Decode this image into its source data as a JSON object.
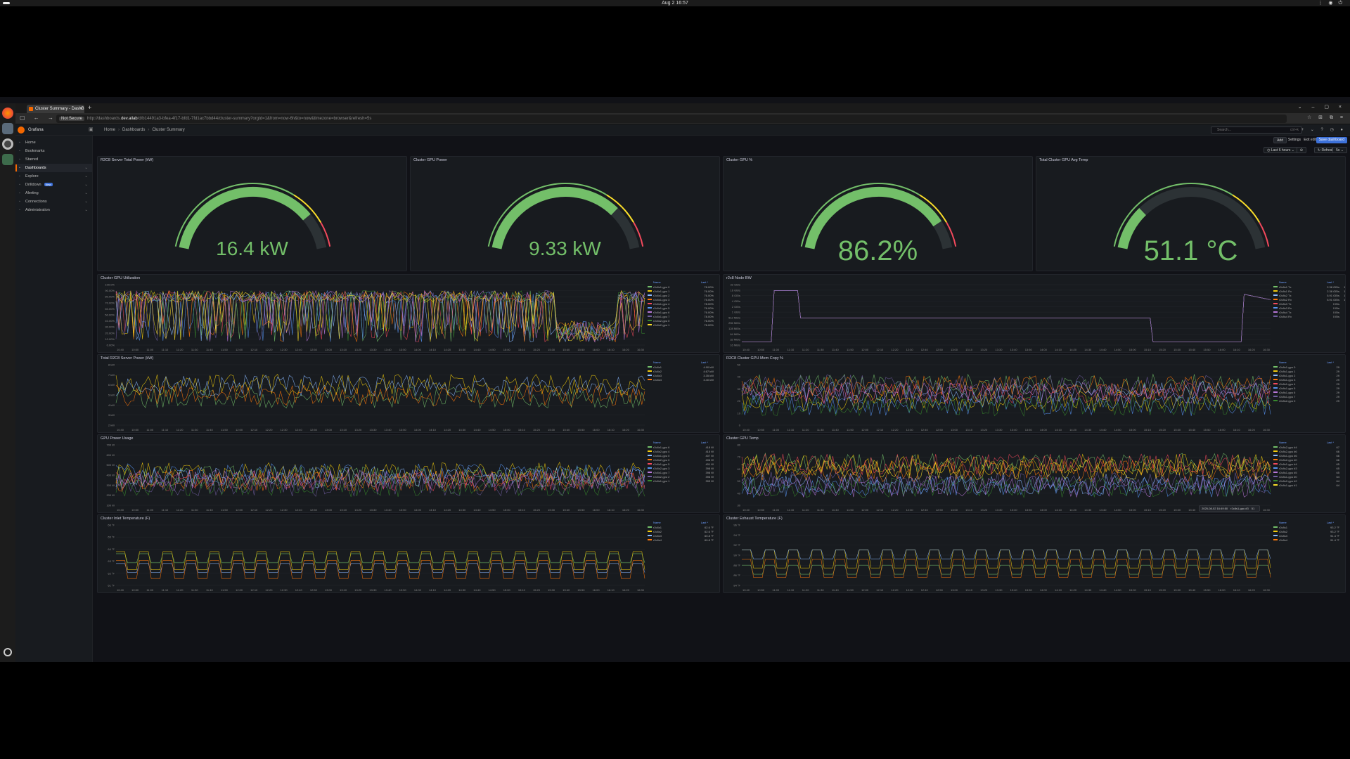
{
  "os": {
    "clock": "Aug 2  16:57"
  },
  "browser": {
    "tab_title": "Cluster Summary - DashB",
    "url_security": "Not Secure",
    "url_prefix": "http://dashboards.",
    "url_domain": "dev.ailab",
    "url_rest": "/d/b14491a3-bfea-4f17-bfd1-7fd1ac7bbd44/cluster-summary?orgId=1&from=now-6h&to=now&timezone=browser&refresh=5s"
  },
  "grafana": {
    "app_name": "Grafana",
    "breadcrumb": [
      "Home",
      "Dashboards",
      "Cluster Summary"
    ],
    "search_placeholder": "Search...",
    "search_shortcut": "ctrl+k",
    "nav": [
      {
        "label": "Home",
        "icon": "home-icon"
      },
      {
        "label": "Bookmarks",
        "icon": "bookmark-icon"
      },
      {
        "label": "Starred",
        "icon": "star-icon"
      },
      {
        "label": "Dashboards",
        "icon": "dashboards-icon",
        "active": true
      },
      {
        "label": "Explore",
        "icon": "compass-icon"
      },
      {
        "label": "Drilldown",
        "icon": "drilldown-icon",
        "badge": "New"
      },
      {
        "label": "Alerting",
        "icon": "bell-icon"
      },
      {
        "label": "Connections",
        "icon": "plug-icon"
      },
      {
        "label": "Administration",
        "icon": "gear-icon"
      }
    ],
    "toolbar": {
      "add": "Add",
      "settings": "Settings",
      "exit_edit": "Exit edit",
      "save": "Save dashboard"
    },
    "timebar": {
      "range": "Last 6 hours",
      "refresh": "Refresh",
      "interval": "5s"
    }
  },
  "gauges": [
    {
      "title": "R2C8 Server Total Power (kW)",
      "value": "16.4 kW",
      "fraction": 0.82,
      "color": "#73bf69"
    },
    {
      "title": "Cluster GPU Power",
      "value": "9.33 kW",
      "fraction": 0.78,
      "color": "#73bf69"
    },
    {
      "title": "Cluster GPU %",
      "value": "86.2%",
      "fraction": 0.862,
      "color": "#73bf69"
    },
    {
      "title": "Total Cluster GPU Avg Temp",
      "value": "51.1 °C",
      "fraction": 0.22,
      "color": "#73bf69"
    }
  ],
  "timeseries": [
    {
      "id": "gpu-util",
      "title": "Cluster GPU Utilization",
      "yticks": [
        "100.0%",
        "90.00%",
        "80.00%",
        "70.00%",
        "60.00%",
        "50.00%",
        "40.00%",
        "30.00%",
        "20.00%",
        "10.00%",
        "0.00%"
      ],
      "legend_cols": [
        "Name",
        "Last *",
        "Max"
      ],
      "legend": [
        [
          "r2c8s1-gpu 0",
          "78.00%",
          "100.00%",
          "#73bf69"
        ],
        [
          "r2c8s1-gpu 1",
          "76.00%",
          "100.00%",
          "#f2cc0c"
        ],
        [
          "r2c8s1-gpu 2",
          "76.00%",
          "100.00%",
          "#8ab8ff"
        ],
        [
          "r2c8s1-gpu 3",
          "75.00%",
          "100.00%",
          "#ff780a"
        ],
        [
          "r2c8s1-gpu 4",
          "78.00%",
          "100.00%",
          "#f2495c"
        ],
        [
          "r2c8s1-gpu 5",
          "76.00%",
          "100.00%",
          "#5794f2"
        ],
        [
          "r2c8s1-gpu 6",
          "76.00%",
          "100.00%",
          "#b877d9"
        ],
        [
          "r2c8s1-gpu 7",
          "78.00%",
          "100.00%",
          "#705da0"
        ],
        [
          "r2c8s2-gpu 0",
          "76.00%",
          "100.00%",
          "#37872d"
        ],
        [
          "r2c8s2-gpu 1",
          "76.00%",
          "100.00%",
          "#fade2a"
        ]
      ]
    },
    {
      "id": "node-bw",
      "title": "r2c8 Node BW",
      "yticks": [
        "32 GB/s",
        "16 GB/s",
        "8 GB/s",
        "4 GB/s",
        "2 GB/s",
        "1 GB/s",
        "512 MB/s",
        "256 MB/s",
        "128 MB/s",
        "64 MB/s",
        "32 MB/s",
        "16 MB/s"
      ],
      "legend_cols": [
        "Name",
        "Last *",
        "Max"
      ],
      "legend": [
        [
          "r2c8s1 Tx",
          "2.38 GB/s",
          "18.4 GB/s",
          "#73bf69"
        ],
        [
          "r2c8s1 Rx",
          "2.38 GB/s",
          "18.4 GB/s",
          "#f2cc0c"
        ],
        [
          "r2c8s2 Tx",
          "5.91 GB/s",
          "19.4 GB/s",
          "#8ab8ff"
        ],
        [
          "r2c8s2 Rx",
          "5.91 GB/s",
          "19.4 GB/s",
          "#ff780a"
        ],
        [
          "r2c8s3 Tx",
          "0 B/s",
          "0 B/s",
          "#f2495c"
        ],
        [
          "r2c8s3 Rx",
          "0 B/s",
          "0 B/s",
          "#5794f2"
        ],
        [
          "r2c8s4 Tx",
          "0 B/s",
          "0 B/s",
          "#b877d9"
        ],
        [
          "r2c8s4 Rx",
          "0 B/s",
          "0 B/s",
          "#705da0"
        ]
      ]
    },
    {
      "id": "server-power",
      "title": "Total R2C8 Server Power (kW)",
      "yticks": [
        "8 kW",
        "7 kW",
        "6 kW",
        "5 kW",
        "4 kW",
        "3 kW",
        "2 kW"
      ],
      "legend_cols": [
        "Name",
        "Last *",
        "Max"
      ],
      "legend": [
        [
          "r2c8s1",
          "4.90 kW",
          "5.17 kW",
          "#73bf69"
        ],
        [
          "r2c8s2",
          "4.67 kW",
          "5.09 kW",
          "#f2cc0c"
        ],
        [
          "r2c8s3",
          "3.35 kW",
          "7.60 kW",
          "#8ab8ff"
        ],
        [
          "r2c8s4",
          "3.40 kW",
          "4.59 kW",
          "#ff780a"
        ]
      ]
    },
    {
      "id": "mem-copy",
      "title": "R2C8 Cluster GPU Mem Copy %",
      "yticks": [
        "50",
        "40",
        "30",
        "20",
        "10",
        "0"
      ],
      "legend_cols": [
        "Name",
        "Last *",
        "Max"
      ],
      "legend": [
        [
          "r2c8s1-gpu 0",
          "29",
          "36",
          "#73bf69"
        ],
        [
          "r2c8s1-gpu 1",
          "29",
          "35",
          "#f2cc0c"
        ],
        [
          "r2c8s1-gpu 2",
          "29",
          "35",
          "#8ab8ff"
        ],
        [
          "r2c8s1-gpu 3",
          "29",
          "35",
          "#ff780a"
        ],
        [
          "r2c8s1-gpu 4",
          "29",
          "35",
          "#f2495c"
        ],
        [
          "r2c8s1-gpu 5",
          "29",
          "35",
          "#5794f2"
        ],
        [
          "r2c8s1-gpu 6",
          "29",
          "35",
          "#b877d9"
        ],
        [
          "r2c8s1-gpu 7",
          "29",
          "35",
          "#705da0"
        ],
        [
          "r2c8s2-gpu 0",
          "29",
          "35",
          "#37872d"
        ]
      ]
    },
    {
      "id": "gpu-power",
      "title": "GPU Power Usage",
      "yticks": [
        "700 W",
        "600 W",
        "500 W",
        "400 W",
        "300 W",
        "200 W",
        "100 W"
      ],
      "legend_cols": [
        "Name",
        "Last *",
        "Max"
      ],
      "legend": [
        [
          "r2c8s1-gpu 6",
          "418 W",
          "544 W",
          "#73bf69"
        ],
        [
          "r2c8s2-gpu 4",
          "415 W",
          "609 W",
          "#f2cc0c"
        ],
        [
          "r2c8s1-gpu 0",
          "407 W",
          "581 W",
          "#8ab8ff"
        ],
        [
          "r2c8s2-gpu 0",
          "406 W",
          "590 W",
          "#ff780a"
        ],
        [
          "r2c8s1-gpu 5",
          "401 W",
          "580 W",
          "#f2495c"
        ],
        [
          "r2c8s2-gpu 3",
          "398 W",
          "602 W",
          "#5794f2"
        ],
        [
          "r2c8s1-gpu 7",
          "398 W",
          "576 W",
          "#b877d9"
        ],
        [
          "r2c8s2-gpu 2",
          "396 W",
          "592 W",
          "#705da0"
        ],
        [
          "r2c8s1-gpu 1",
          "393 W",
          "588 W",
          "#37872d"
        ]
      ]
    },
    {
      "id": "gpu-temp",
      "title": "Cluster GPU Temp",
      "yticks": [
        "80",
        "70",
        "60",
        "50",
        "40",
        "30"
      ],
      "legend_cols": [
        "Name",
        "Last *",
        "Max"
      ],
      "legend": [
        [
          "r2c8s2-gpu #4",
          "67",
          "77",
          "#73bf69"
        ],
        [
          "r2c8s2-gpu #6",
          "66",
          "75",
          "#f2cc0c"
        ],
        [
          "r2c8s1-gpu #6",
          "66",
          "73",
          "#8ab8ff"
        ],
        [
          "r2c8s2-gpu #0",
          "66",
          "76",
          "#ff780a"
        ],
        [
          "r2c8s1-gpu #4",
          "65",
          "73",
          "#f2495c"
        ],
        [
          "r2c8s2-gpu #3",
          "65",
          "76",
          "#5794f2"
        ],
        [
          "r2c8s1-gpu #5",
          "65",
          "72",
          "#b877d9"
        ],
        [
          "r2c8s1-gpu #0",
          "64",
          "73",
          "#705da0"
        ],
        [
          "r2c8s2-gpu #2",
          "64",
          "75",
          "#37872d"
        ],
        [
          "r2c8s1-gpu #1",
          "64",
          "72",
          "#fade2a"
        ]
      ],
      "tooltip": {
        "time": "2025-08-02 16:49:50",
        "series": "r2c8s1-gpu #3",
        "value": "51"
      }
    },
    {
      "id": "inlet-temp",
      "title": "Cluster Inlet Temperature (F)",
      "yticks": [
        "66 °F",
        "65 °F",
        "64 °F",
        "63 °F",
        "62 °F",
        "61 °F"
      ],
      "legend_cols": [
        "Name",
        "Last *",
        "Max"
      ],
      "legend": [
        [
          "r2c8s1",
          "62.6 °F",
          "66.2 °F",
          "#73bf69"
        ],
        [
          "r2c8s2",
          "62.6 °F",
          "66.2 °F",
          "#f2cc0c"
        ],
        [
          "r2c8s3",
          "60.8 °F",
          "64.4 °F",
          "#8ab8ff"
        ],
        [
          "r2c8s4",
          "60.8 °F",
          "64.4 °F",
          "#ff780a"
        ]
      ]
    },
    {
      "id": "exhaust-temp",
      "title": "Cluster Exhaust Temperature (F)",
      "yticks": [
        "96 °F",
        "94 °F",
        "92 °F",
        "90 °F",
        "88 °F",
        "86 °F",
        "84 °F"
      ],
      "legend_cols": [
        "Name",
        "Last *",
        "Max"
      ],
      "legend": [
        [
          "r2c8s1",
          "93.2 °F",
          "95.2 °F",
          "#73bf69"
        ],
        [
          "r2c8s2",
          "93.2 °F",
          "95.2 °F",
          "#f2cc0c"
        ],
        [
          "r2c8s3",
          "91.4 °F",
          "95 °F",
          "#8ab8ff"
        ],
        [
          "r2c8s4",
          "91.4 °F",
          "95 °F",
          "#ff780a"
        ]
      ]
    }
  ],
  "xticks": [
    "10:40",
    "10:50",
    "11:00",
    "11:10",
    "11:20",
    "11:30",
    "11:40",
    "11:50",
    "12:00",
    "12:10",
    "12:20",
    "12:30",
    "12:40",
    "12:50",
    "13:00",
    "13:10",
    "13:20",
    "13:30",
    "13:40",
    "13:50",
    "14:00",
    "14:10",
    "14:20",
    "14:30",
    "14:40",
    "14:50",
    "15:00",
    "15:10",
    "15:20",
    "15:30",
    "15:40",
    "15:50",
    "16:00",
    "16:10",
    "16:20",
    "16:30"
  ]
}
